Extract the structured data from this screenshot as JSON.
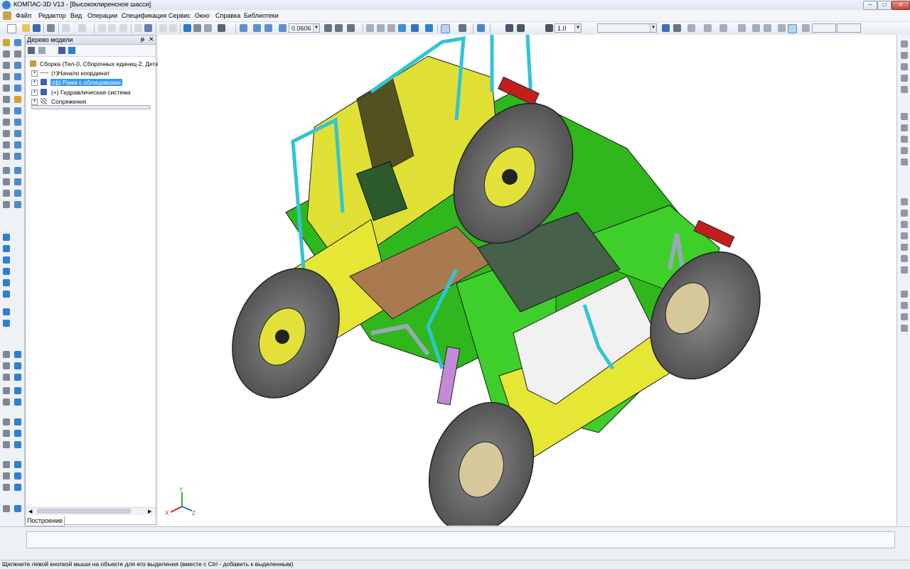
{
  "window": {
    "title": "КОМПАС-3D V13 - [Высококлиренсное шасси]",
    "minimize": "–",
    "maximize": "□",
    "close": "✕"
  },
  "menu": [
    {
      "label": "Файл"
    },
    {
      "label": "Редактор"
    },
    {
      "label": "Вид"
    },
    {
      "label": "Операции"
    },
    {
      "label": "Спецификация"
    },
    {
      "label": "Сервис"
    },
    {
      "label": "Окно"
    },
    {
      "label": "Справка"
    },
    {
      "label": "Библиотеки"
    }
  ],
  "toolbar": {
    "zoom_value": "0.0606",
    "step_value": "1.0"
  },
  "model_tree": {
    "title": "Дерево модели",
    "pin": "ᵽ",
    "close": "✕",
    "root": "Сборка (Тел-0, Сборочных единиц-2, Детал",
    "nodes": [
      {
        "label": "(т)Начало координат",
        "selected": false
      },
      {
        "label": "(ф) Рама с облицовками",
        "selected": true
      },
      {
        "label": "(+) Гидравлическая система",
        "selected": false
      },
      {
        "label": "Сопряжения",
        "selected": false
      }
    ],
    "tab": "Построение"
  },
  "axes": {
    "x": "X",
    "y": "Y",
    "z": "Z"
  },
  "status": {
    "hint": "Щелкните левой кнопкой мыши на объекте для его выделения (вместе с Ctrl - добавить к выделенным)"
  },
  "colors": {
    "frame_green": "#31c41f",
    "cab_yellow": "#e6e630",
    "accent_cyan": "#2fc5d4",
    "tire_gray": "#6b6b6b",
    "selection": "#3399ff"
  }
}
